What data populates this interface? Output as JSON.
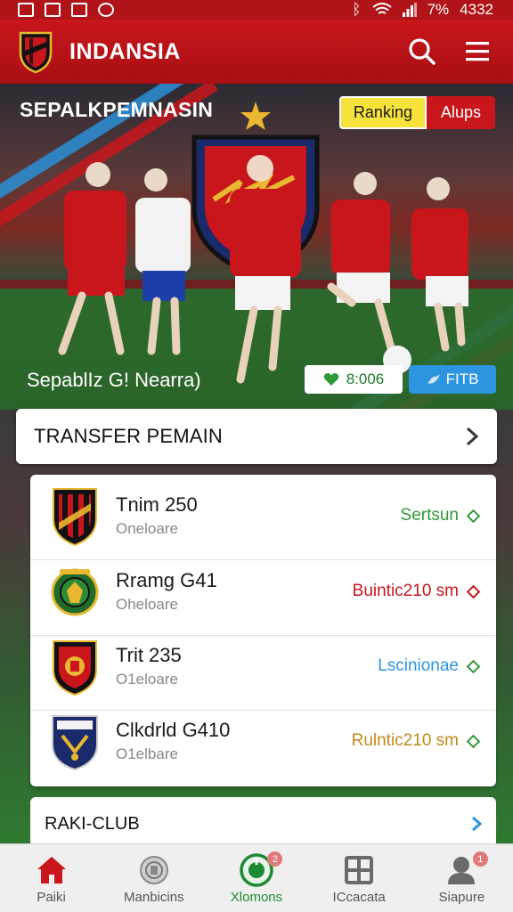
{
  "status_bar": {
    "battery": "7%",
    "time": "4332"
  },
  "app_bar": {
    "title": "INDANSIA"
  },
  "hero": {
    "title": "SEPALKPEMNASIN",
    "ranking_label": "Ranking",
    "alus_label": "Alups",
    "caption": "SepablΙz G! Nearra)",
    "like_count": "8:006",
    "share_label": "FITB"
  },
  "transfer_section": {
    "title": "TRANSFER PEMAIN"
  },
  "transfers": [
    {
      "name": "Tnim 250",
      "sub": "Oneloare",
      "status": "Sertsun",
      "status_color": "#2e9a36"
    },
    {
      "name": "Rramg G41",
      "sub": "Oheloare",
      "status": "Buintic210 sm",
      "status_color": "#c8161c"
    },
    {
      "name": "Trit 235",
      "sub": "O1eloare",
      "status": "Lscinionae",
      "status_color": "#2d95e0"
    },
    {
      "name": "Clkdrld G410",
      "sub": "O1elbare",
      "status": "Rulntic210 sm",
      "status_color": "#c08a1a"
    }
  ],
  "club_section": {
    "title": "RAKI-CLUB"
  },
  "bottom_nav": [
    {
      "label": "Paiki",
      "icon": "home-icon"
    },
    {
      "label": "Manbicins",
      "icon": "badge-icon"
    },
    {
      "label": "Xlomons",
      "icon": "live-icon",
      "badge": "2"
    },
    {
      "label": "ICcacata",
      "icon": "grid-icon"
    },
    {
      "label": "Siapure",
      "icon": "profile-icon",
      "badge": "1"
    }
  ],
  "colors": {
    "brand_red": "#c8161c",
    "accent_green": "#1d8a32",
    "accent_blue": "#2d95e0",
    "chip_yellow": "#f6e23a"
  }
}
